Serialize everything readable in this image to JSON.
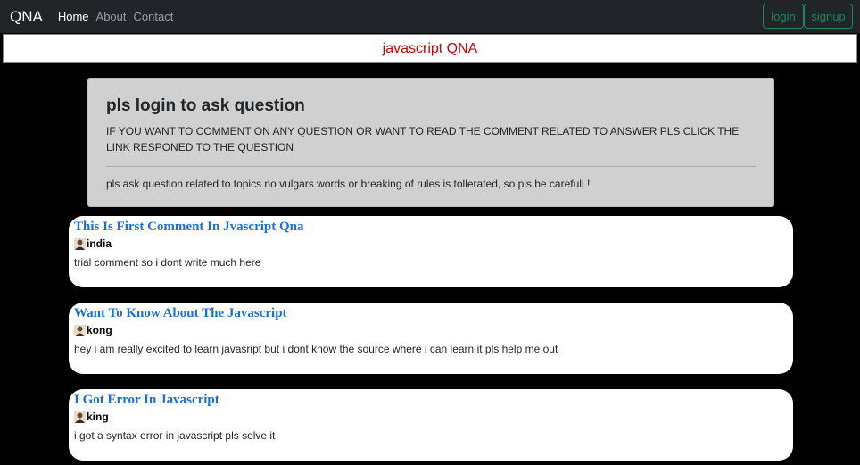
{
  "nav": {
    "brand": "QNA",
    "links": [
      "Home",
      "About",
      "Contact"
    ],
    "login_label": "login",
    "signup_label": "signup"
  },
  "subheader": {
    "title": "javascript QNA"
  },
  "notice": {
    "title": "pls login to ask question",
    "lead": "IF YOU WANT TO COMMENT ON ANY QUESTION OR WANT TO READ THE COMMENT RELATED TO ANSWER PLS CLICK THE LINK RESPONED TO THE QUESTION",
    "rules": "pls ask question related to topics no vulgars words or breaking of rules is tollerated, so pls be carefull !"
  },
  "questions": [
    {
      "title": "This Is First Comment In Jvascript Qna",
      "user": "india",
      "body": "trial comment so i dont write much here"
    },
    {
      "title": "Want To Know About The Javascript",
      "user": "kong",
      "body": "hey i am really excited to learn javasript but i dont know the source where i can learn it pls help me out"
    },
    {
      "title": "I Got Error In Javascript",
      "user": "king",
      "body": "i got a syntax error in javascript pls solve it"
    }
  ],
  "colors": {
    "navbar": "#212529",
    "accent_green": "#198754",
    "title_red": "#d40000",
    "question_link": "#1a6ed8"
  },
  "icons": {
    "user": "user-avatar-icon"
  }
}
